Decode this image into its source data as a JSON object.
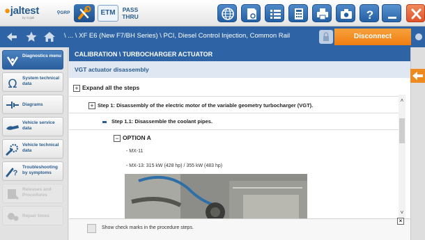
{
  "app": {
    "logo_text": "jaltest",
    "logo_sub": "by Cojali",
    "grp_label": "GRP",
    "etm_label": "ETM",
    "pass_label_1": "PASS",
    "pass_label_2": "THRU"
  },
  "navbar": {
    "breadcrumb": "\\ ... \\ XF E6 (New F7/BH Series) \\ PCI, Diesel Control Injection, Common Rail",
    "disconnect_label": "Disconnect"
  },
  "sidebar": {
    "items": [
      {
        "label": "Diagnostics menu",
        "icon": "diagnostics-icon",
        "state": "active"
      },
      {
        "label": "System technical data",
        "icon": "omega-icon",
        "state": "normal"
      },
      {
        "label": "Diagrams",
        "icon": "diagram-icon",
        "state": "normal"
      },
      {
        "label": "Vehicle service data",
        "icon": "service-icon",
        "state": "normal"
      },
      {
        "label": "Vehicle technical data",
        "icon": "wrench-gear-icon",
        "state": "normal"
      },
      {
        "label": "Troubleshooting by symptoms",
        "icon": "troubleshoot-icon",
        "state": "normal"
      },
      {
        "label": "Releases and Procedures",
        "icon": "releases-icon",
        "state": "disabled"
      },
      {
        "label": "Repair times",
        "icon": "repair-times-icon",
        "state": "disabled"
      }
    ]
  },
  "main": {
    "header": "CALIBRATION \\ TURBOCHARGER ACTUATOR",
    "subheader": "VGT actuator disassembly",
    "expand_label": "Expand all the steps",
    "step1": "Step 1: Disassembly of the electric motor of the variable geometry turbocharger (VGT).",
    "step1_1": "Step 1.1: Disassemble the coolant pipes.",
    "option_a": "OPTION A",
    "mx11": "- MX-11",
    "mx13": "- MX-13: 315 kW (428 hp) / 355 kW (483 hp)",
    "checkmarks_label": "Show check marks in the procedure steps."
  },
  "colors": {
    "primary_blue": "#2e64a5",
    "accent_orange": "#ef7e12",
    "close_red": "#e0522a"
  }
}
